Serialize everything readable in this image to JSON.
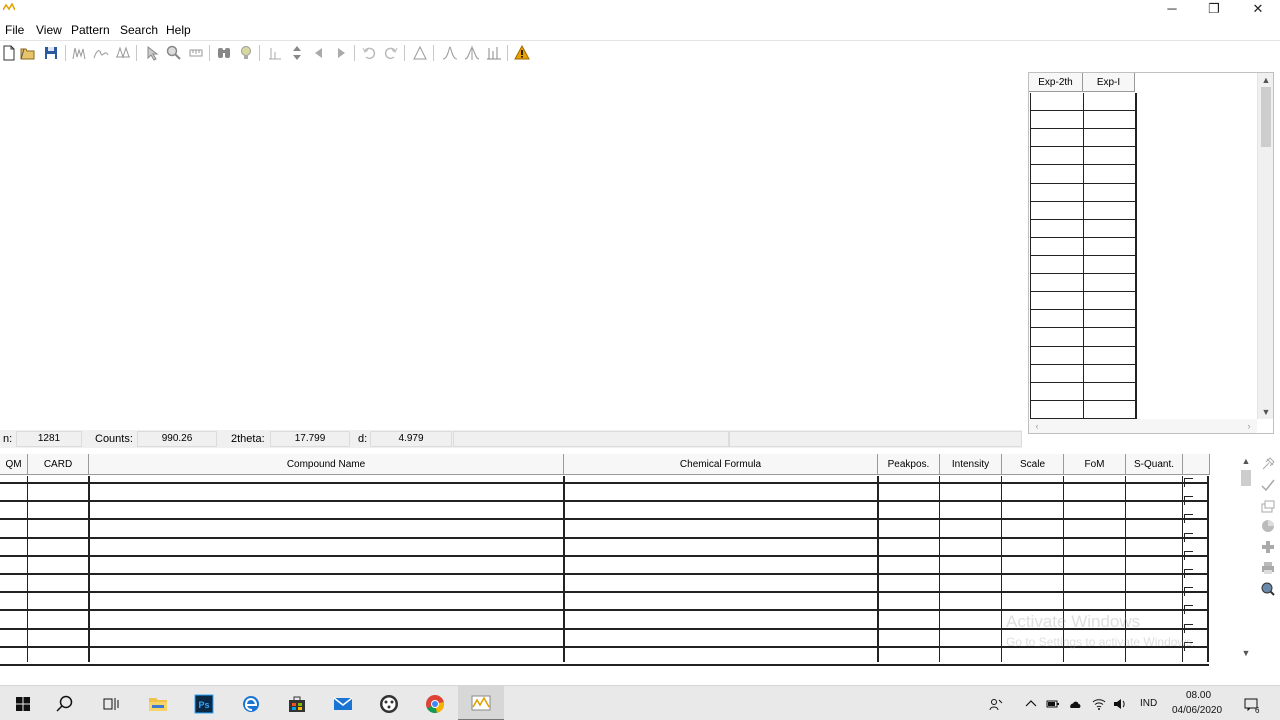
{
  "window": {
    "minimize": "─",
    "restore": "❐",
    "close": "✕"
  },
  "menu": {
    "items": [
      "File",
      "View",
      "Pattern",
      "Search",
      "Help"
    ]
  },
  "peak_list": {
    "columns": [
      "Exp-2th",
      "Exp-I"
    ],
    "row_count": 18
  },
  "status": {
    "n_label": "n:",
    "n_value": "1281",
    "counts_label": "Counts:",
    "counts_value": "990.26",
    "theta_label": "2theta:",
    "theta_value": "17.799",
    "d_label": "d:",
    "d_value": "4.979"
  },
  "results": {
    "columns": [
      "QM",
      "CARD",
      "Compound Name",
      "Chemical Formula",
      "Peakpos.",
      "Intensity",
      "Scale",
      "FoM",
      "S-Quant."
    ],
    "row_count": 10
  },
  "watermark": {
    "title": "Activate Windows",
    "subtitle": "Go to Settings to activate Windows."
  },
  "taskbar": {
    "tray_lang": "IND",
    "clock_time": "08.00",
    "clock_date": "04/06/2020",
    "notification_count": "6"
  },
  "colors": {
    "accent_warning": "#e8a400",
    "taskbar_bg": "#e9e9e9",
    "grid_line": "#222222"
  }
}
